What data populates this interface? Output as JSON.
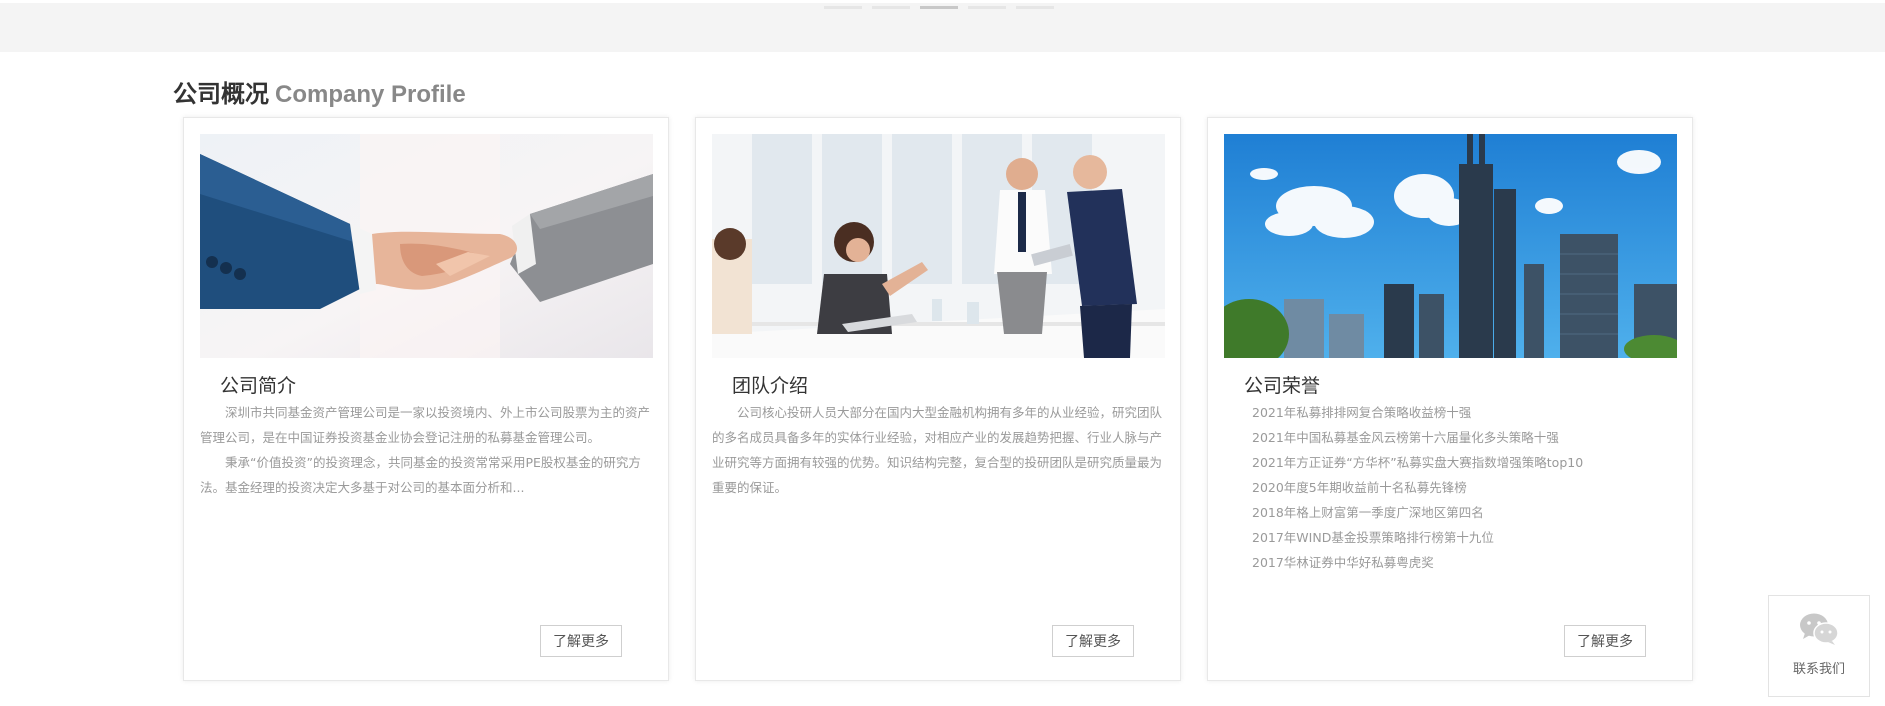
{
  "section": {
    "title_cn": "公司概况",
    "title_en": "Company Profile"
  },
  "cards": [
    {
      "title": "公司简介",
      "image": "handshake-photo",
      "paragraphs": [
        "深圳市共同基金资产管理公司是一家以投资境内、外上市公司股票为主的资产管理公司，是在中国证券投资基金业协会登记注册的私募基金管理公司。",
        "秉承“价值投资”的投资理念，共同基金的投资常常采用PE股权基金的研究方法。基金经理的投资决定大多基于对公司的基本面分析和..."
      ],
      "more_label": "了解更多"
    },
    {
      "title": "团队介绍",
      "image": "team-meeting-photo",
      "paragraphs": [
        "公司核心投研人员大部分在国内大型金融机构拥有多年的从业经验，研究团队的多名成员具备多年的实体行业经验，对相应产业的发展趋势把握、行业人脉与产业研究等方面拥有较强的优势。知识结构完整，复合型的投研团队是研究质量最为重要的保证。"
      ],
      "more_label": "了解更多"
    },
    {
      "title": "公司荣誉",
      "image": "city-skyline-photo",
      "honors": [
        "2021年私募排排网复合策略收益榜十强",
        "2021年中国私募基金风云榜第十六届量化多头策略十强",
        "2021年方正证券“方华杯”私募实盘大赛指数增强策略top10",
        "2020年度5年期收益前十名私募先锋榜",
        "2018年格上财富第一季度广深地区第四名",
        "2017年WIND基金投票策略排行榜第十九位",
        "2017华林证券中华好私募粤虎奖"
      ],
      "more_label": "了解更多"
    }
  ],
  "contact": {
    "label": "联系我们",
    "icon": "wechat-icon"
  }
}
